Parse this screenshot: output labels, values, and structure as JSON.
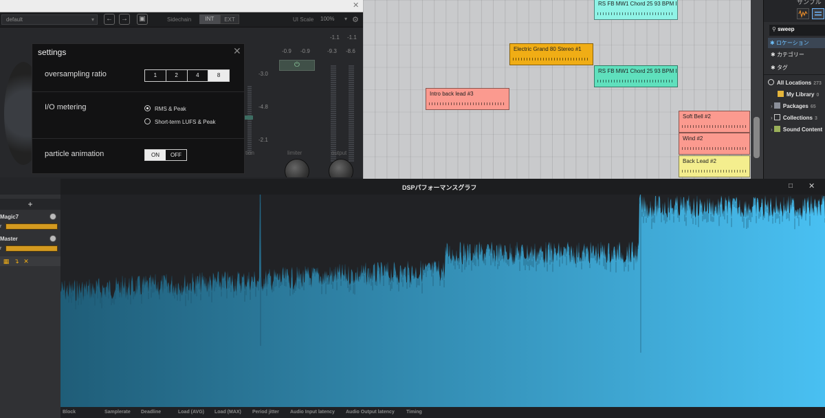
{
  "plugin": {
    "preset": "default",
    "sidechain_label": "Sidechain",
    "sidechain_int": "INT",
    "sidechain_ext": "EXT",
    "ui_scale_label": "UI Scale",
    "ui_scale_value": "100%",
    "meters": {
      "top_left": "-0.9",
      "top_left2": "-0.9",
      "top_right": "-1.1",
      "top_right2": "-1.1",
      "row2_right": "-9.3",
      "row2_right2": "-8.6",
      "scale_1": "-3.0",
      "scale_2": "-4.8",
      "scale_3": "-2.1"
    },
    "knobs": {
      "limiter": "limiter",
      "output": "output",
      "partial_left": "tion"
    }
  },
  "settings": {
    "title": "settings",
    "oversampling_label": "oversampling ratio",
    "oversampling_options": [
      "1",
      "2",
      "4",
      "8"
    ],
    "oversampling_selected": "8",
    "io_metering_label": "I/O metering",
    "io_options": [
      "RMS & Peak",
      "Short-term LUFS & Peak"
    ],
    "io_selected": "RMS & Peak",
    "particle_label": "particle animation",
    "particle_on": "ON",
    "particle_off": "OFF",
    "particle_state": "ON"
  },
  "arranger": {
    "clips": [
      {
        "label": "RS FB MW1 Chord 25 93 BPM I",
        "color": "cyan"
      },
      {
        "label": "Electric Grand 80 Stereo #1",
        "color": "orange"
      },
      {
        "label": "RS FB MW1 Chord 25 93 BPM I",
        "color": "green"
      },
      {
        "label": "Intro back lead #3",
        "color": "salmon"
      },
      {
        "label": "Soft Bell #2",
        "color": "salmon"
      },
      {
        "label": "Wind #2",
        "color": "salmon"
      },
      {
        "label": "Back Lead #2",
        "color": "yellow"
      }
    ]
  },
  "browser": {
    "partial_title": "サンプル",
    "search": "sweep",
    "items": [
      {
        "label": "ロケーション",
        "selected": true
      },
      {
        "label": "カテゴリー",
        "selected": false
      },
      {
        "label": "タグ",
        "selected": false
      }
    ],
    "locations": [
      {
        "label": "All Locations",
        "count": "273"
      },
      {
        "label": "My Library",
        "count": "0"
      },
      {
        "label": "Packages",
        "count": "65"
      },
      {
        "label": "Collections",
        "count": "3"
      },
      {
        "label": "Sound Content",
        "count": ""
      }
    ]
  },
  "mixer": {
    "add": "+",
    "channels": [
      {
        "name": "Magic7",
        "tag": "r"
      },
      {
        "name": "Master",
        "tag": "r"
      }
    ]
  },
  "dsp": {
    "title": "DSPパフォーマンスグラフ",
    "maximize_icon": "□",
    "close_icon": "✕",
    "stats": [
      "Block",
      "Samplerate",
      "Deadline",
      "Load (AVG)",
      "Load (MAX)",
      "Period jitter",
      "Audio Input latency",
      "Audio Output latency",
      "Timing"
    ],
    "fill_color_start": "#1f5d78",
    "fill_color_end": "#49c0f2"
  }
}
